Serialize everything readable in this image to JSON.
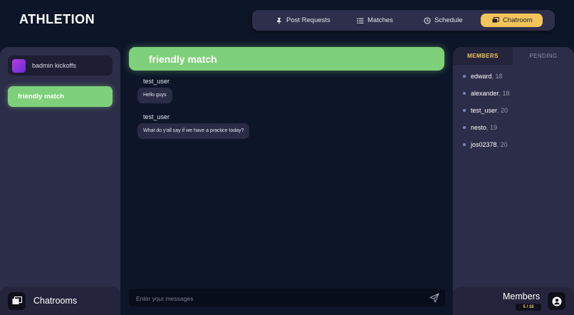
{
  "app": {
    "title": "ATHLETION"
  },
  "nav": {
    "items": [
      {
        "label": "Post Requests",
        "icon": "pin-icon"
      },
      {
        "label": "Matches",
        "icon": "list-icon"
      },
      {
        "label": "Schedule",
        "icon": "clock-icon"
      },
      {
        "label": "Chatroom",
        "icon": "chat-icon",
        "active": true
      }
    ],
    "active_color": "#f3c45a"
  },
  "chatrooms": {
    "items": [
      {
        "label": "badmin kickoffs"
      },
      {
        "label": "friendly match",
        "active": true
      }
    ],
    "footer_label": "Chatrooms"
  },
  "chat": {
    "title": "friendly match",
    "accent_color": "#7fd07a",
    "messages": [
      {
        "user": "test_user",
        "text": "Hello guys"
      },
      {
        "user": "test_user",
        "text": "What do y'all say if we have a practice today?"
      }
    ],
    "input_placeholder": "Enter your messages"
  },
  "members_panel": {
    "tabs": [
      {
        "label": "MEMBERS",
        "active": true
      },
      {
        "label": "PENDING"
      }
    ],
    "members": [
      {
        "name": "edward",
        "age": ", 18"
      },
      {
        "name": "alexander",
        "age": ", 18"
      },
      {
        "name": "test_user",
        "age": ", 20"
      },
      {
        "name": "nesto",
        "age": ", 19"
      },
      {
        "name": "jos02378",
        "age": ", 20"
      }
    ],
    "footer_label": "Members",
    "count": "5 / 16"
  }
}
